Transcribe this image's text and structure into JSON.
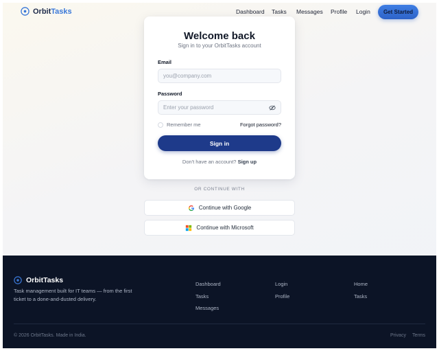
{
  "brand": {
    "name_prefix": "Orbit",
    "name_suffix": "Tasks"
  },
  "nav": {
    "links": [
      "Dashboard",
      "Tasks",
      "Messages",
      "Profile",
      "Login"
    ],
    "cta": "Get Started"
  },
  "login": {
    "title": "Welcome back",
    "subtitle": "Sign in to your OrbitTasks account",
    "email_label": "Email",
    "email_placeholder": "you@company.com",
    "password_label": "Password",
    "password_placeholder": "Enter your password",
    "remember": "Remember me",
    "forgot": "Forgot password?",
    "submit": "Sign in",
    "signup_prompt": "Don't have an account?",
    "signup_link": "Sign up"
  },
  "oauth": {
    "divider": "OR CONTINUE WITH",
    "google": "Continue with Google",
    "microsoft": "Continue with Microsoft"
  },
  "footer": {
    "brand": "OrbitTasks",
    "description": "Task management built for IT teams — from the first ticket to a done-and-dusted delivery.",
    "col1": [
      "Dashboard",
      "Tasks",
      "Messages"
    ],
    "col2": [
      "Login",
      "Profile"
    ],
    "col3": [
      "Home",
      "Tasks"
    ],
    "copyright": "© 2026 OrbitTasks. Made in India.",
    "legal": [
      "Privacy",
      "Terms"
    ]
  },
  "colors": {
    "accent": "#3a78d8",
    "primary_button": "#1e3a8a",
    "footer_bg": "#0c1426"
  },
  "icons": {
    "brand": "orbit-icon",
    "password_toggle": "eye-off-icon",
    "google": "google-icon",
    "microsoft": "microsoft-icon"
  }
}
